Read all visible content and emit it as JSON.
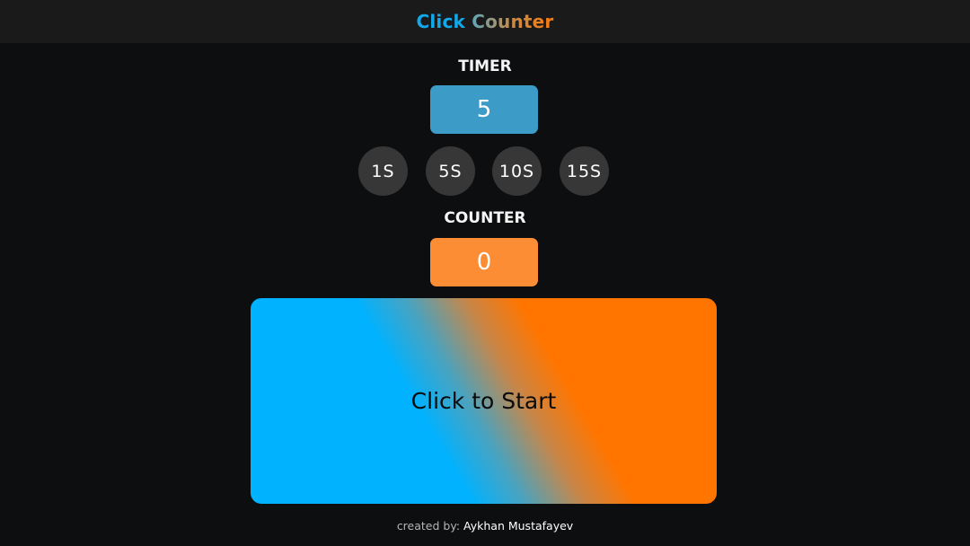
{
  "header": {
    "title_part1": "Click",
    "title_part2": "Counter"
  },
  "timer": {
    "label": "TIMER",
    "value": "5"
  },
  "presets": [
    {
      "label": "1S"
    },
    {
      "label": "5S"
    },
    {
      "label": "10S"
    },
    {
      "label": "15S"
    }
  ],
  "counter": {
    "label": "COUNTER",
    "value": "0"
  },
  "click_area": {
    "label": "Click to Start"
  },
  "footer": {
    "prefix": "created by:",
    "author": "Aykhan Mustafayev"
  },
  "colors": {
    "background": "#0d0e10",
    "header_bg": "#1a1a1a",
    "accent_blue": "#00b2ff",
    "accent_orange": "#ff7500",
    "timer_box": "#3d9bc8",
    "counter_box": "#fd8d35",
    "preset_bg": "#373737"
  }
}
